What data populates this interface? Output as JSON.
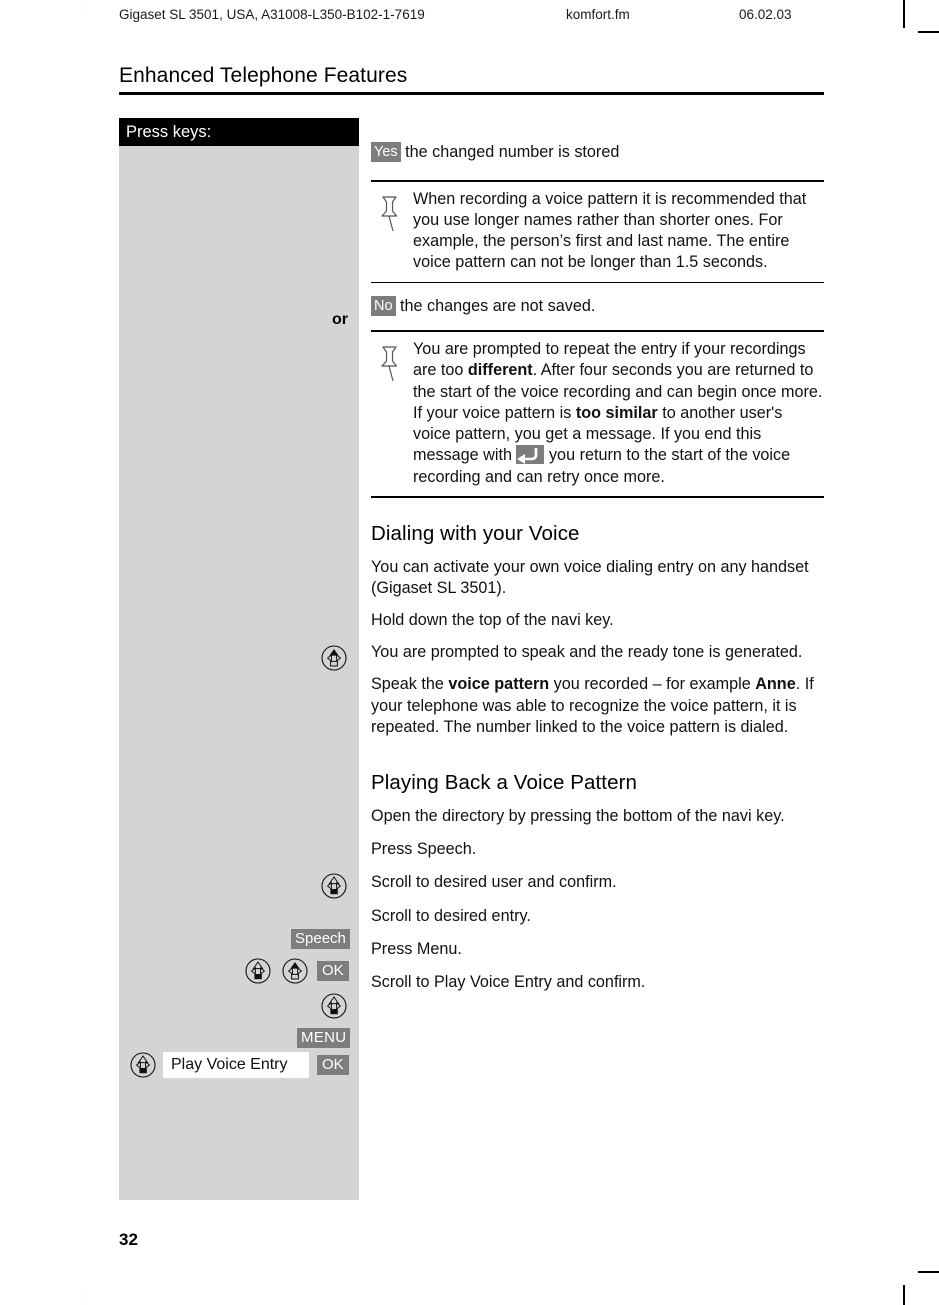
{
  "running_header": {
    "document_id": "Gigaset SL 3501, USA, A31008-L350-B102-1-7619",
    "filename": "komfort.fm",
    "date": "06.02.03"
  },
  "chapter_title": "Enhanced Telephone Features",
  "key_column": {
    "header": "Press keys:",
    "or_label": "or",
    "keys": {
      "speech": "Speech",
      "ok": "OK",
      "menu": "MENU",
      "display_entry": "Play Voice Entry"
    }
  },
  "content": {
    "step_yes": {
      "key": "Yes",
      "text": "the changed number is stored"
    },
    "note_1": "When recording a voice pattern it is recommended that you use longer names rather than shorter ones.  For example, the person’s first and last name.  The entire voice pattern can not be longer than 1.5 seconds.",
    "step_no": {
      "key": "No",
      "text": "the changes are not saved."
    },
    "note_2": {
      "part_1": "You are prompted to repeat the entry if your recordings are too ",
      "bold_1": "different",
      "part_2": ". After four seconds you are returned to the start of the voice recording and can begin once more.",
      "part_3": "If your voice pattern is ",
      "bold_2": "too similar",
      "part_4": " to another user's voice pattern, you get a message. If you end this message with ",
      "part_5": " you return to the start of the voice recording and can retry once more."
    },
    "section_dialing": {
      "heading": "Dialing with your Voice",
      "p1": "You can activate your own voice dialing entry on any handset (Gigaset SL 3501).",
      "p2": "Hold down the top of the navi key.",
      "p3": "You are prompted to speak and the ready tone is generated.",
      "p4_part1": "Speak the ",
      "p4_bold1": "voice pattern",
      "p4_part2": " you recorded – for example ",
      "p4_bold2": "Anne",
      "p4_part3": ". If your telephone was able to recognize the voice pattern, it is repeated. The number linked to the voice pattern is dialed."
    },
    "section_playback": {
      "heading": "Playing Back a Voice Pattern",
      "steps": [
        {
          "text": "Open the directory by pressing the bottom of the navi key."
        },
        {
          "text": "Press Speech."
        },
        {
          "text": "Scroll to desired user and confirm."
        },
        {
          "text": "Scroll to desired entry."
        },
        {
          "text": "Press Menu."
        },
        {
          "text": "Scroll to Play Voice Entry and confirm."
        }
      ]
    }
  },
  "page_number": "32",
  "colors": {
    "key_column_bg": "#d4d4d4",
    "key_header_bg": "#000000",
    "display_key_bg": "#7d7d7d",
    "display_key_fg": "#ffffff",
    "text": "#111111"
  }
}
